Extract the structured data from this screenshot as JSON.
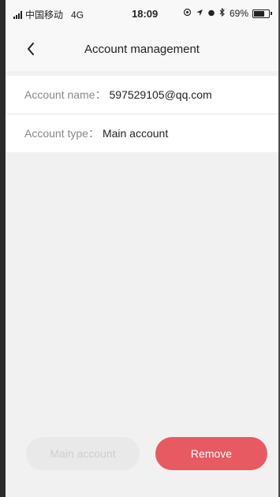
{
  "status_bar": {
    "carrier": "中国移动",
    "network": "4G",
    "time": "18:09",
    "battery_percent": "69%"
  },
  "nav": {
    "title": "Account management",
    "back_icon": "chevron-left-icon"
  },
  "account": {
    "name_label": "Account name：",
    "name_value": "597529105@qq.com",
    "type_label": "Account type：",
    "type_value": "Main account"
  },
  "actions": {
    "main_account_label": "Main account",
    "remove_label": "Remove"
  },
  "colors": {
    "remove_button": "#e85a62",
    "disabled_button": "#e9e9e9",
    "background": "#f1f1f1"
  }
}
